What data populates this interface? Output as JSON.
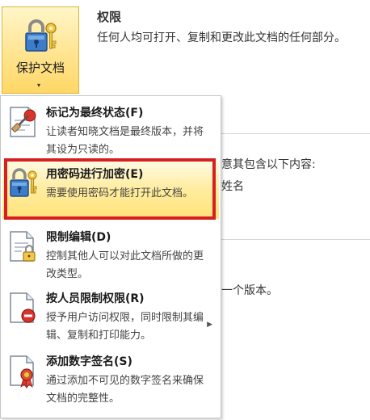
{
  "protect_button": {
    "label": "保护文档",
    "arrow": "▾",
    "icon": "lock-key-icon"
  },
  "permissions": {
    "title": "权限",
    "description": "任何人均可打开、复制和更改此文档的任何部分。"
  },
  "background_text": {
    "line1": "意其包含以下内容:",
    "line2": "姓名",
    "line3": "一个版本。"
  },
  "menu": {
    "items": [
      {
        "icon": "mark-final-icon",
        "title": "标记为最终状态(F)",
        "description": "让读者知晓文档是最终版本，并将其设为只读的。"
      },
      {
        "icon": "encrypt-lock-icon",
        "title": "用密码进行加密(E)",
        "description": "需要使用密码才能打开此文档。"
      },
      {
        "icon": "restrict-editing-icon",
        "title": "限制编辑(D)",
        "description": "控制其他人可以对此文档所做的更改类型。"
      },
      {
        "icon": "restrict-permission-icon",
        "title": "按人员限制权限(R)",
        "description": "授予用户访问权限，同时限制其编辑、复制和打印能力。",
        "submenu_arrow": "▶"
      },
      {
        "icon": "digital-signature-icon",
        "title": "添加数字签名(S)",
        "description": "通过添加不可见的数字签名来确保文档的完整性。"
      }
    ]
  },
  "colors": {
    "highlight_border": "#d62020",
    "highlight_fill": "#ffe37a"
  }
}
